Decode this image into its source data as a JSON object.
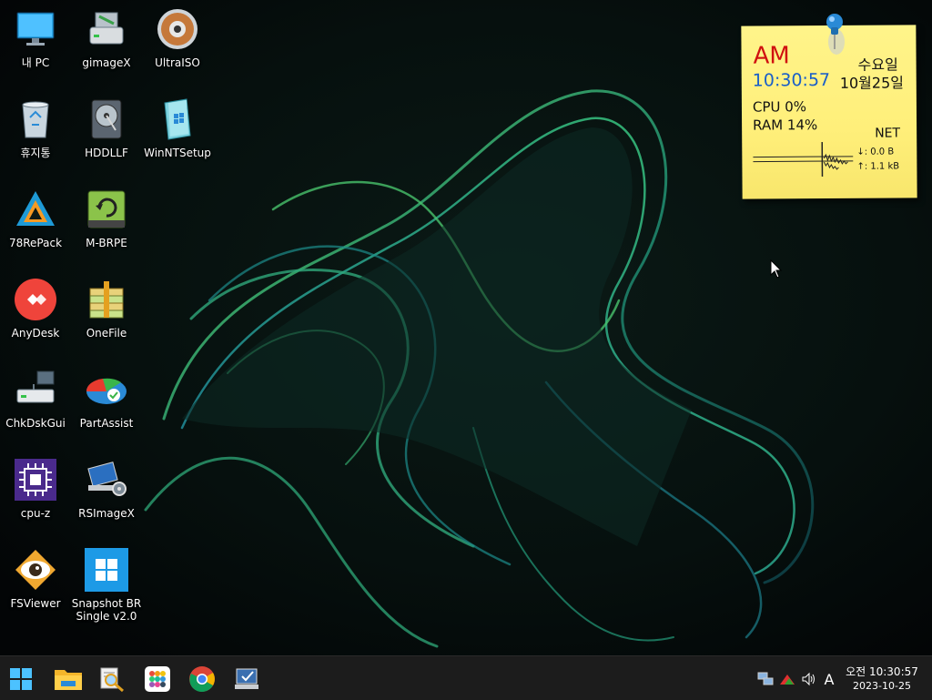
{
  "desktop": {
    "icons": [
      {
        "label": "내 PC",
        "icon": "computer-icon"
      },
      {
        "label": "휴지통",
        "icon": "recycle-bin-icon"
      },
      {
        "label": "78RePack",
        "icon": "78repack-icon"
      },
      {
        "label": "AnyDesk",
        "icon": "anydesk-icon"
      },
      {
        "label": "ChkDskGui",
        "icon": "chkdsk-icon"
      },
      {
        "label": "cpu-z",
        "icon": "cpu-z-icon"
      },
      {
        "label": "FSViewer",
        "icon": "fsviewer-icon"
      },
      {
        "label": "gimageX",
        "icon": "gimagex-icon"
      },
      {
        "label": "HDDLLF",
        "icon": "hddllf-icon"
      },
      {
        "label": "M-BRPE",
        "icon": "m-brpe-icon"
      },
      {
        "label": "OneFile",
        "icon": "onefile-icon"
      },
      {
        "label": "PartAssist",
        "icon": "partassist-icon"
      },
      {
        "label": "RSImageX",
        "icon": "rsimagex-icon"
      },
      {
        "label": "Snapshot BR\nSingle v2.0",
        "icon": "snapshot-icon"
      },
      {
        "label": "UltraISO",
        "icon": "ultraiso-icon"
      },
      {
        "label": "WinNTSetup",
        "icon": "winntsetup-icon"
      }
    ]
  },
  "widget": {
    "ampm": "AM",
    "time": "10:30:57",
    "weekday": "수요일",
    "date": "10월25일",
    "cpu": "CPU  0%",
    "ram": "RAM  14%",
    "net_label": "NET",
    "down": "↓: 0.0 B",
    "up": "↑: 1.1 kB",
    "colors": {
      "ampm": "#d01010",
      "time": "#1a5fc8",
      "note": "#fff48a"
    }
  },
  "taskbar": {
    "pinned": [
      "start-icon",
      "file-explorer-icon",
      "search-tool-icon",
      "app-launcher-icon",
      "chrome-icon",
      "system-tool-icon"
    ],
    "tray": [
      "network-icon",
      "tray-app-icon",
      "volume-icon",
      "input-mode-icon"
    ],
    "input_mode": "A",
    "clock_time": "오전 10:30:57",
    "clock_date": "2023-10-25"
  }
}
